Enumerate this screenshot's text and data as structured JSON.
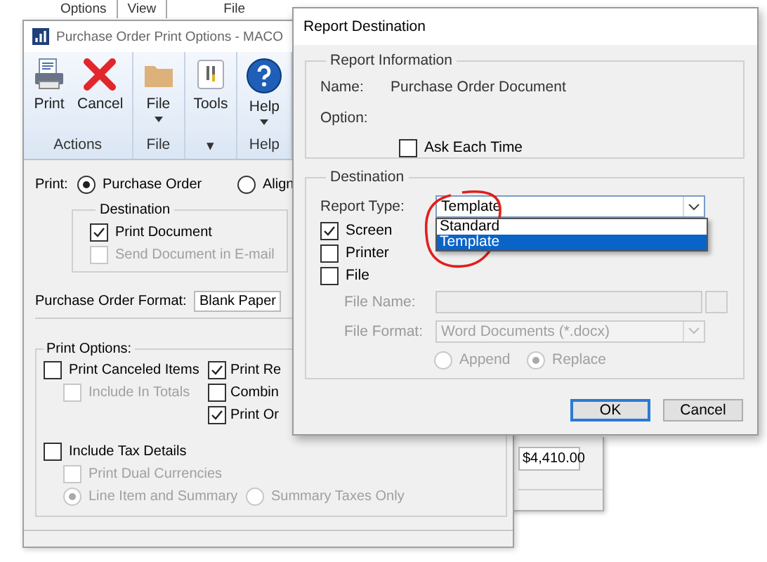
{
  "background_menu": [
    "Options",
    "View",
    "File"
  ],
  "background_window": {
    "amount": "$4,410.00"
  },
  "print_options_window": {
    "title": "Purchase Order Print Options - MACO",
    "ribbon": [
      {
        "label": "Actions",
        "buttons": [
          {
            "kind": "print",
            "label": "Print",
            "dropdown": false
          },
          {
            "kind": "cancel",
            "label": "Cancel",
            "dropdown": false
          }
        ]
      },
      {
        "label": "File",
        "buttons": [
          {
            "kind": "folder",
            "label": "File",
            "dropdown": true
          }
        ]
      },
      {
        "label": "▾",
        "buttons": [
          {
            "kind": "tools",
            "label": "Tools",
            "dropdown": false
          }
        ]
      },
      {
        "label": "Help",
        "buttons": [
          {
            "kind": "help",
            "label": "Help",
            "dropdown": true
          }
        ]
      }
    ],
    "print_label": "Print:",
    "print_choices": [
      {
        "label": "Purchase Order",
        "selected": true
      },
      {
        "label": "Align",
        "selected": false
      }
    ],
    "destination": {
      "title": "Destination",
      "options": [
        {
          "label": "Print Document",
          "checked": true,
          "disabled": false
        },
        {
          "label": "Send Document in E-mail",
          "checked": false,
          "disabled": true
        }
      ]
    },
    "format": {
      "label": "Purchase Order Format:",
      "value": "Blank Paper"
    },
    "print_options": {
      "title": "Print Options:",
      "left": [
        {
          "label": "Print Canceled Items",
          "checked": false,
          "disabled": false
        },
        {
          "label": "Include In Totals",
          "checked": false,
          "disabled": true
        }
      ],
      "right": [
        {
          "label": "Print Re",
          "checked": true,
          "disabled": false
        },
        {
          "label": "Combin",
          "checked": false,
          "disabled": false
        },
        {
          "label": "Print Or",
          "checked": true,
          "disabled": false
        }
      ],
      "tax": {
        "label": "Include Tax Details",
        "checked": false,
        "disabled": false
      },
      "dual": {
        "label": "Print Dual Currencies",
        "checked": false,
        "disabled": true
      },
      "tax_modes": [
        {
          "label": "Line Item and Summary",
          "selected": true,
          "disabled": true
        },
        {
          "label": "Summary Taxes Only",
          "selected": false,
          "disabled": true
        }
      ]
    }
  },
  "report_destination": {
    "title": "Report Destination",
    "report_information": {
      "title": "Report Information",
      "name_label": "Name:",
      "name_value": "Purchase Order Document",
      "option_label": "Option:",
      "ask_each_time": {
        "label": "Ask Each Time",
        "checked": false,
        "disabled": false
      }
    },
    "destination": {
      "title": "Destination",
      "report_type": {
        "label": "Report Type:",
        "value": "Template",
        "expanded": true,
        "options": [
          {
            "label": "Standard",
            "selected": false
          },
          {
            "label": "Template",
            "selected": true
          }
        ]
      },
      "targets": [
        {
          "label": "Screen",
          "checked": true,
          "disabled": false
        },
        {
          "label": "Printer",
          "checked": false,
          "disabled": false
        },
        {
          "label": "File",
          "checked": false,
          "disabled": false
        }
      ],
      "file_name": {
        "label": "File Name:",
        "disabled": true
      },
      "file_format": {
        "label": "File Format:",
        "value": "Word Documents (*.docx)",
        "disabled": true
      },
      "write_modes": [
        {
          "label": "Append",
          "selected": false,
          "disabled": true
        },
        {
          "label": "Replace",
          "selected": true,
          "disabled": true
        }
      ]
    },
    "buttons": [
      {
        "label": "OK",
        "default": true
      },
      {
        "label": "Cancel",
        "default": false
      }
    ]
  },
  "annotations": [
    {
      "kind": "circle"
    }
  ]
}
